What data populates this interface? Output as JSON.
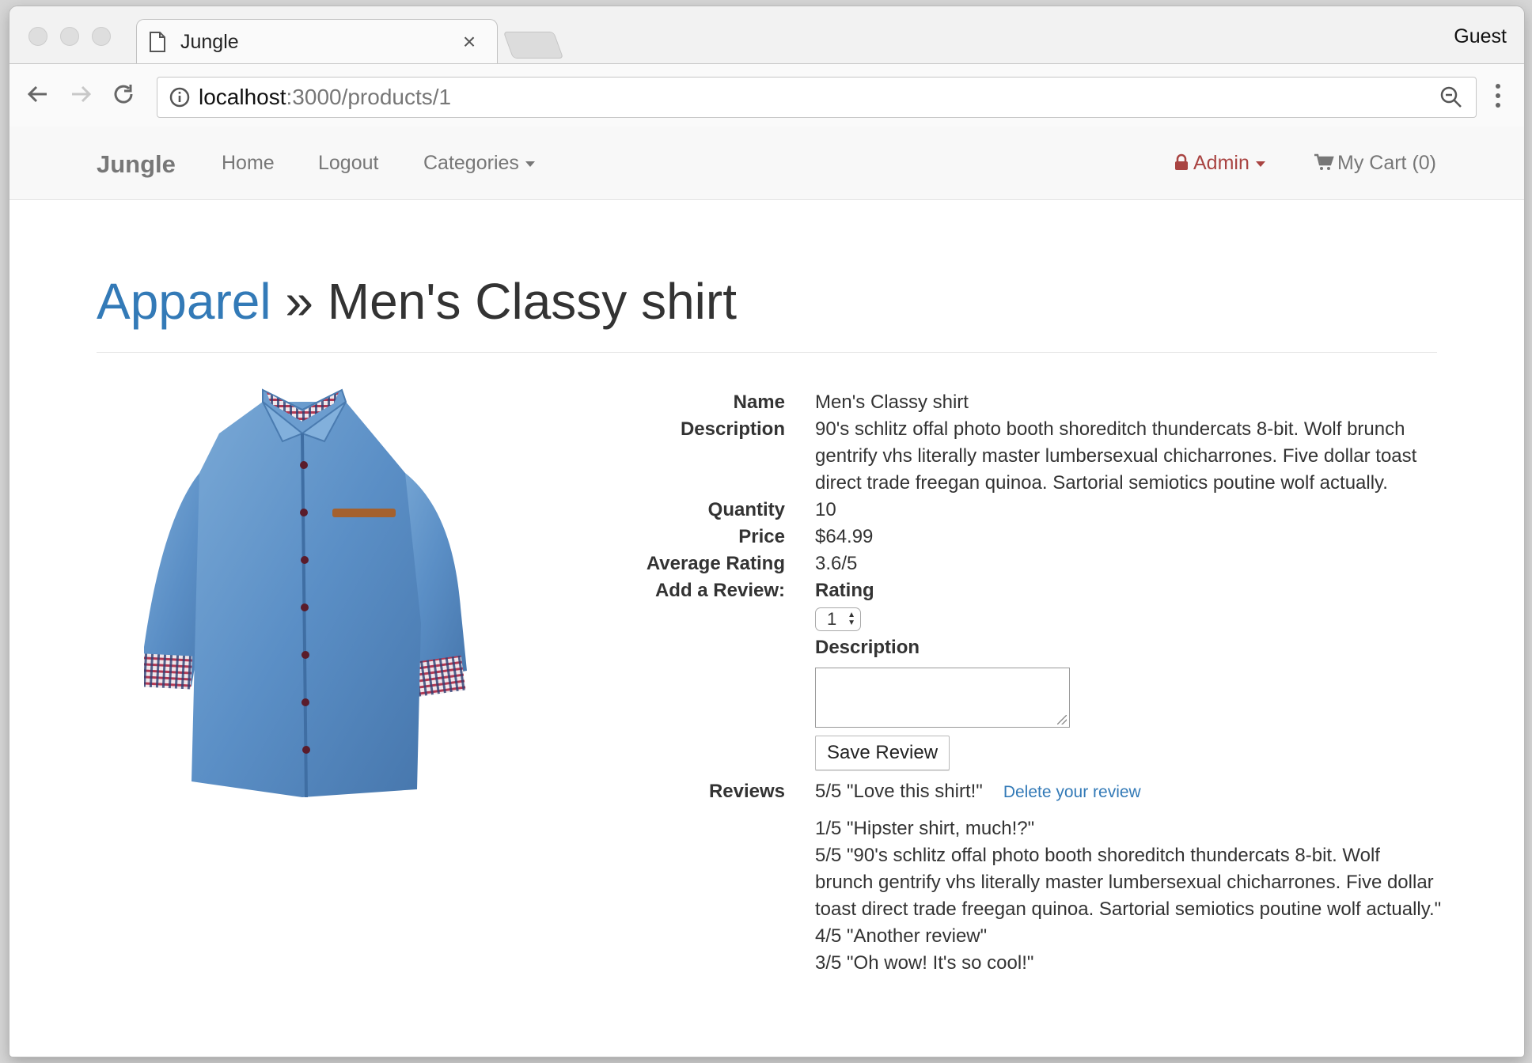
{
  "browser": {
    "tab_title": "Jungle",
    "tab_close": "×",
    "profile": "Guest",
    "url_host": "localhost",
    "url_path": ":3000/products/1"
  },
  "site": {
    "brand": "Jungle",
    "nav": {
      "home": "Home",
      "logout": "Logout",
      "categories": "Categories",
      "admin": "Admin",
      "cart": "My Cart (0)"
    }
  },
  "product": {
    "category": "Apparel",
    "separator": " » ",
    "title": "Men's Classy shirt",
    "labels": {
      "name": "Name",
      "description": "Description",
      "quantity": "Quantity",
      "price": "Price",
      "average_rating": "Average Rating",
      "add_review": "Add a Review:",
      "reviews": "Reviews"
    },
    "name": "Men's Classy shirt",
    "description": "90's schlitz offal photo booth shoreditch thundercats 8-bit. Wolf brunch gentrify vhs literally master lumbersexual chicharrones. Five dollar toast direct trade freegan quinoa. Sartorial semiotics poutine wolf actually.",
    "quantity": "10",
    "price": "$64.99",
    "average_rating": "3.6/5"
  },
  "review_form": {
    "rating_label": "Rating",
    "rating_value": "1",
    "description_label": "Description",
    "description_value": "",
    "save_label": "Save Review"
  },
  "reviews": {
    "delete_label": "Delete your review",
    "items": [
      "5/5 \"Love this shirt!\"",
      "1/5 \"Hipster shirt, much!?\"",
      "5/5 \"90's schlitz offal photo booth shoreditch thundercats 8-bit. Wolf brunch gentrify vhs literally master lumbersexual chicharrones. Five dollar toast direct trade freegan quinoa. Sartorial semiotics poutine wolf actually.\"",
      "4/5 \"Another review\"",
      "3/5 \"Oh wow! It's so cool!\""
    ]
  },
  "colors": {
    "link_blue": "#337ab7",
    "admin_red": "#a94442",
    "nav_gray": "#777777"
  }
}
